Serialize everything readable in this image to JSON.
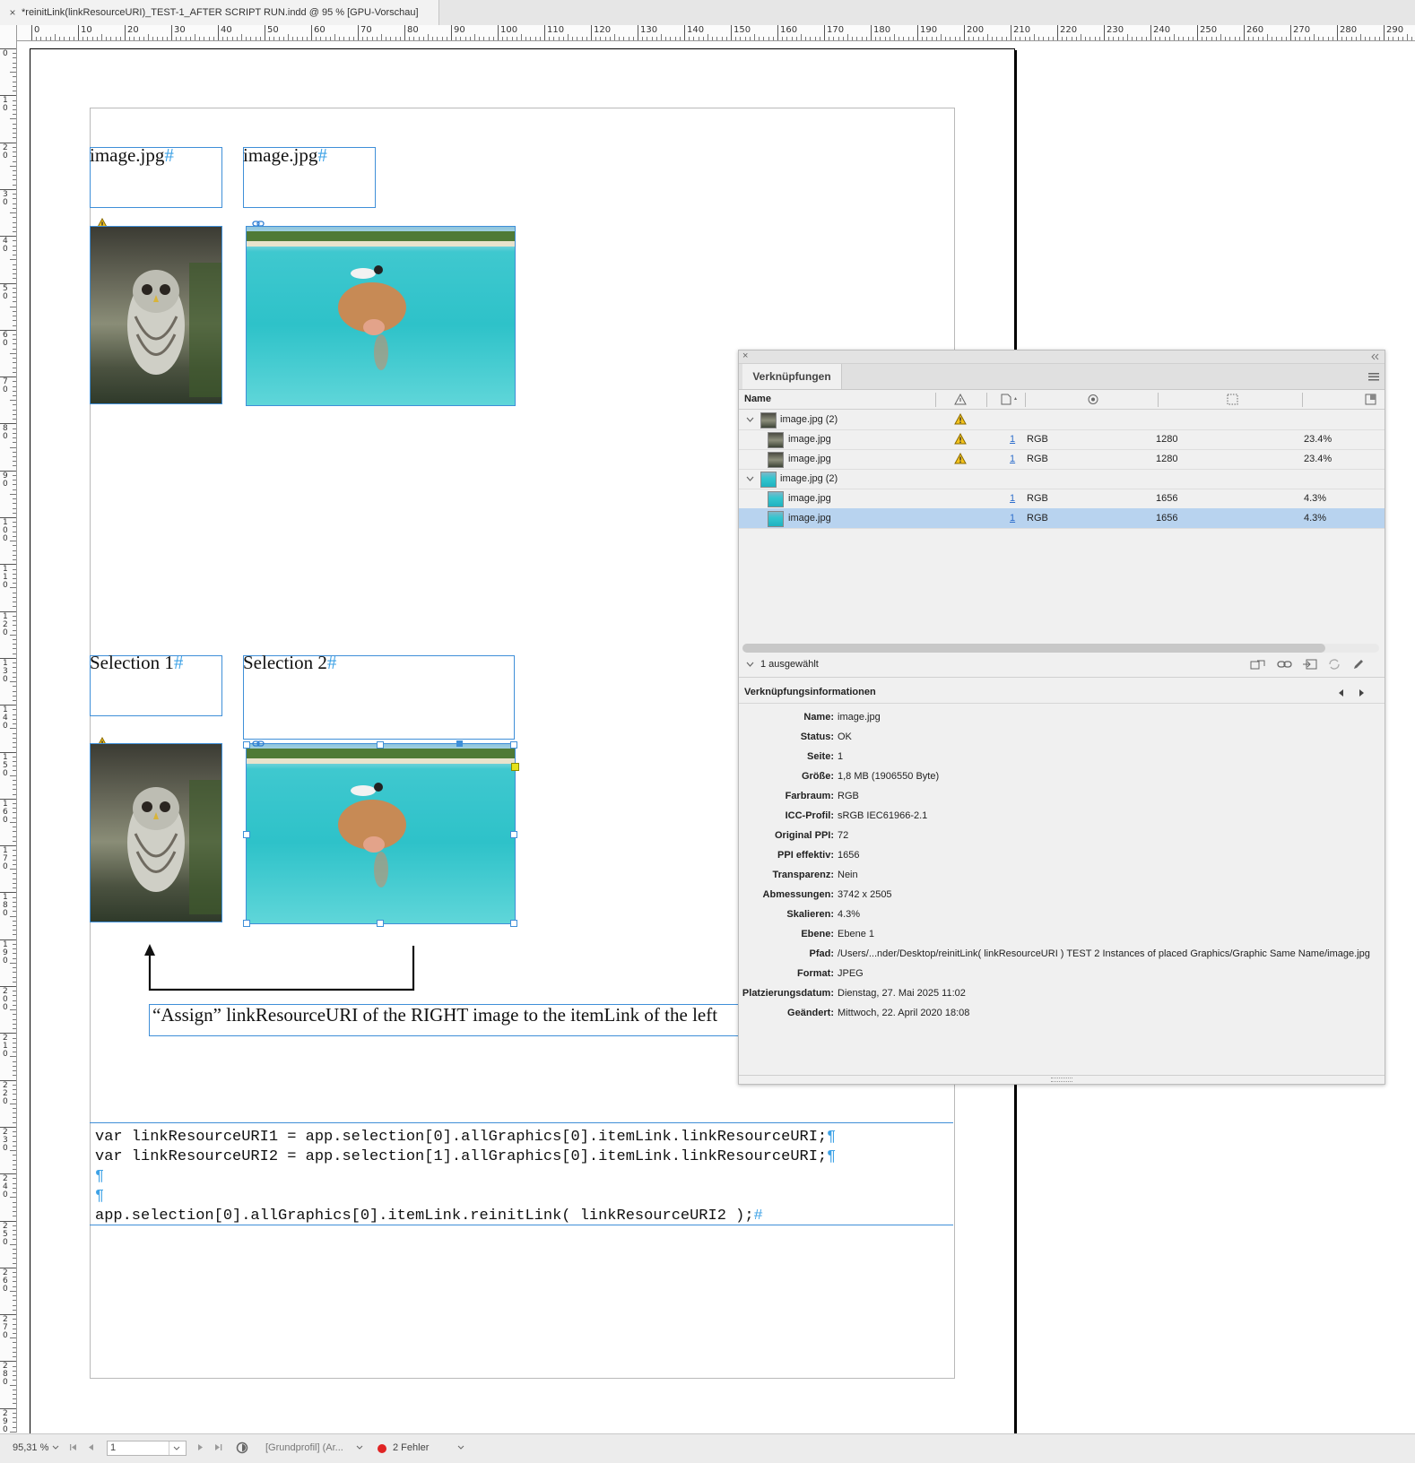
{
  "window": {
    "tab_title": "*reinitLink(linkResourceURI)_TEST-1_AFTER SCRIPT RUN.indd @ 95 % [GPU-Vorschau]",
    "close_glyph": "×"
  },
  "ruler": {
    "h_labels": [
      "0",
      "10",
      "20",
      "30",
      "40",
      "50",
      "60",
      "70",
      "80",
      "90",
      "100",
      "110",
      "120",
      "130",
      "140",
      "150",
      "160",
      "170",
      "180",
      "190",
      "200",
      "210",
      "220",
      "230",
      "240",
      "250",
      "260",
      "270",
      "280",
      "290"
    ],
    "v_labels": [
      "0",
      "10",
      "20",
      "30",
      "40",
      "50",
      "60",
      "70",
      "80",
      "90",
      "100",
      "110",
      "120",
      "130",
      "140",
      "150",
      "160",
      "170",
      "180",
      "190",
      "200",
      "210",
      "220",
      "230",
      "240",
      "250",
      "260",
      "270",
      "280",
      "290"
    ]
  },
  "document": {
    "caption_1": "image.jpg",
    "caption_2": "image.jpg",
    "selection_1": "Selection 1",
    "selection_2": "Selection 2",
    "hash": "#",
    "assign_text": "“Assign” linkResourceURI of the RIGHT image to the itemLink of the left",
    "code": [
      "var linkResourceURI1 = app.selection[0].allGraphics[0].itemLink.linkResourceURI;",
      "var linkResourceURI2 = app.selection[1].allGraphics[0].itemLink.linkResourceURI;",
      "",
      "",
      "app.selection[0].allGraphics[0].itemLink.reinitLink( linkResourceURI2 );"
    ],
    "pilcrow": "¶",
    "colors": {
      "frame": "#3f8fd8",
      "hash": "#3ea2e6"
    }
  },
  "links_panel": {
    "tab": "Verknüpfungen",
    "col_name": "Name",
    "rows": [
      {
        "name": "image.jpg (2)",
        "group": true,
        "warn": true,
        "page": "",
        "color": "",
        "ppi": "",
        "scale": "",
        "thumb": "owl"
      },
      {
        "name": "image.jpg",
        "group": false,
        "warn": true,
        "page": "1",
        "color": "RGB",
        "ppi": "1280",
        "scale": "23.4%",
        "thumb": "owl"
      },
      {
        "name": "image.jpg",
        "group": false,
        "warn": true,
        "page": "1",
        "color": "RGB",
        "ppi": "1280",
        "scale": "23.4%",
        "thumb": "owl"
      },
      {
        "name": "image.jpg (2)",
        "group": true,
        "warn": false,
        "page": "",
        "color": "",
        "ppi": "",
        "scale": "",
        "thumb": "sea"
      },
      {
        "name": "image.jpg",
        "group": false,
        "warn": false,
        "page": "1",
        "color": "RGB",
        "ppi": "1656",
        "scale": "4.3%",
        "thumb": "sea"
      },
      {
        "name": "image.jpg",
        "group": false,
        "warn": false,
        "page": "1",
        "color": "RGB",
        "ppi": "1656",
        "scale": "4.3%",
        "thumb": "sea",
        "selected": true
      }
    ],
    "selected_count": "1 ausgewählt",
    "info_title": "Verknüpfungsinformationen",
    "info": [
      {
        "label": "Name:",
        "value": "image.jpg"
      },
      {
        "label": "Status:",
        "value": "OK"
      },
      {
        "label": "Seite:",
        "value": "1"
      },
      {
        "label": "Größe:",
        "value": "1,8 MB (1906550 Byte)"
      },
      {
        "label": "Farbraum:",
        "value": "RGB"
      },
      {
        "label": "ICC-Profil:",
        "value": "sRGB IEC61966-2.1"
      },
      {
        "label": "Original PPI:",
        "value": "72"
      },
      {
        "label": "PPI effektiv:",
        "value": "1656"
      },
      {
        "label": "Transparenz:",
        "value": "Nein"
      },
      {
        "label": "Abmessungen:",
        "value": "3742 x 2505"
      },
      {
        "label": "Skalieren:",
        "value": "4.3%"
      },
      {
        "label": "Ebene:",
        "value": "Ebene 1"
      },
      {
        "label": "Pfad:",
        "value": "/Users/...nder/Desktop/reinitLink( linkResourceURI ) TEST 2 Instances of placed Graphics/Graphic Same Name/image.jpg"
      },
      {
        "label": "Format:",
        "value": "JPEG"
      },
      {
        "label": "Platzierungsdatum:",
        "value": "Dienstag, 27. Mai 2025 11:02"
      },
      {
        "label": "Geändert:",
        "value": "Mittwoch, 22. April 2020 18:08"
      }
    ]
  },
  "statusbar": {
    "zoom": "95,31 %",
    "page": "1",
    "profile": "[Grundprofil] (Ar...",
    "errors": "2 Fehler",
    "error_color": "#e02424"
  }
}
